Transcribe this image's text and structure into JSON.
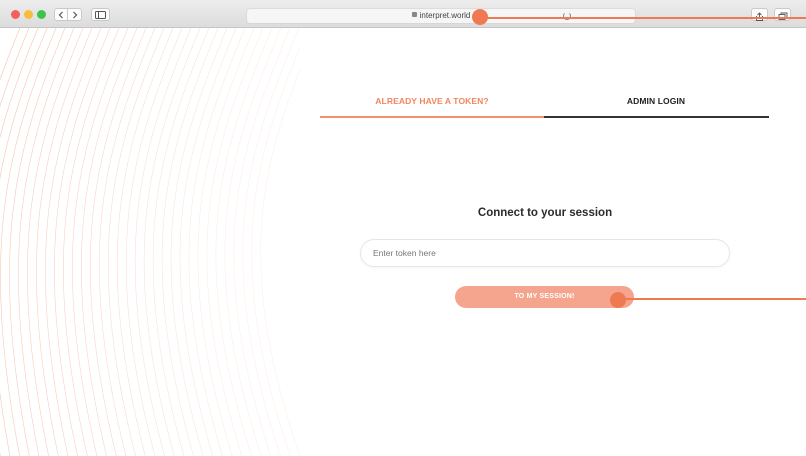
{
  "browser": {
    "url": "interpret.world"
  },
  "tabs": [
    {
      "label": "ALREADY HAVE A TOKEN?",
      "active": true
    },
    {
      "label": "ADMIN LOGIN",
      "active": false
    }
  ],
  "form": {
    "heading": "Connect to your session",
    "token_placeholder": "Enter token here",
    "token_value": "",
    "submit_label": "TO MY SESSION!"
  },
  "colors": {
    "accent": "#ef8660",
    "button": "#f5a58e",
    "marker": "#ef7a52",
    "text_dark": "#222222"
  },
  "icons": [
    "back-arrow-icon",
    "forward-arrow-icon",
    "sidebar-icon",
    "lock-icon",
    "reload-icon",
    "share-icon",
    "tabs-icon"
  ]
}
